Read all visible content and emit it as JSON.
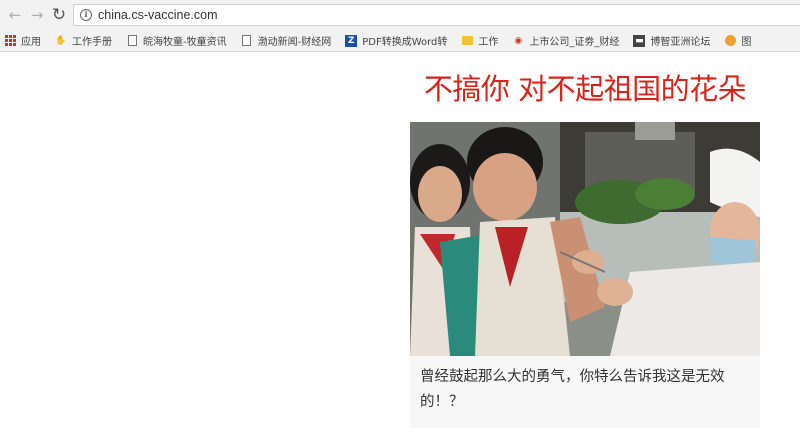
{
  "browser": {
    "url": "china.cs-vaccine.com",
    "nav": {
      "back_icon": "back-arrow-icon",
      "forward_icon": "forward-arrow-icon",
      "reload_icon": "reload-icon"
    },
    "bookmarks": [
      {
        "label": "应用",
        "icon": "apps-grid-icon"
      },
      {
        "label": "工作手册",
        "icon": "grab-icon"
      },
      {
        "label": "皖海牧童-牧童资讯",
        "icon": "page-icon"
      },
      {
        "label": "渤动新闻-财经网",
        "icon": "page-icon"
      },
      {
        "label": "PDF转换成Word转",
        "icon": "z-icon"
      },
      {
        "label": "工作",
        "icon": "folder-icon"
      },
      {
        "label": "上市公司_证劵_财经",
        "icon": "weibo-icon"
      },
      {
        "label": "博智亚洲论坛",
        "icon": "note-icon"
      },
      {
        "label": "图",
        "icon": "orange-circle-icon"
      }
    ]
  },
  "article": {
    "headline": "不搞你 对不起祖国的花朵",
    "caption": "曾经鼓起那么大的勇气，你特么告诉我这是无效的！？"
  },
  "colors": {
    "headline": "#d9241b",
    "toolbar_bg": "#f2f2f2"
  }
}
